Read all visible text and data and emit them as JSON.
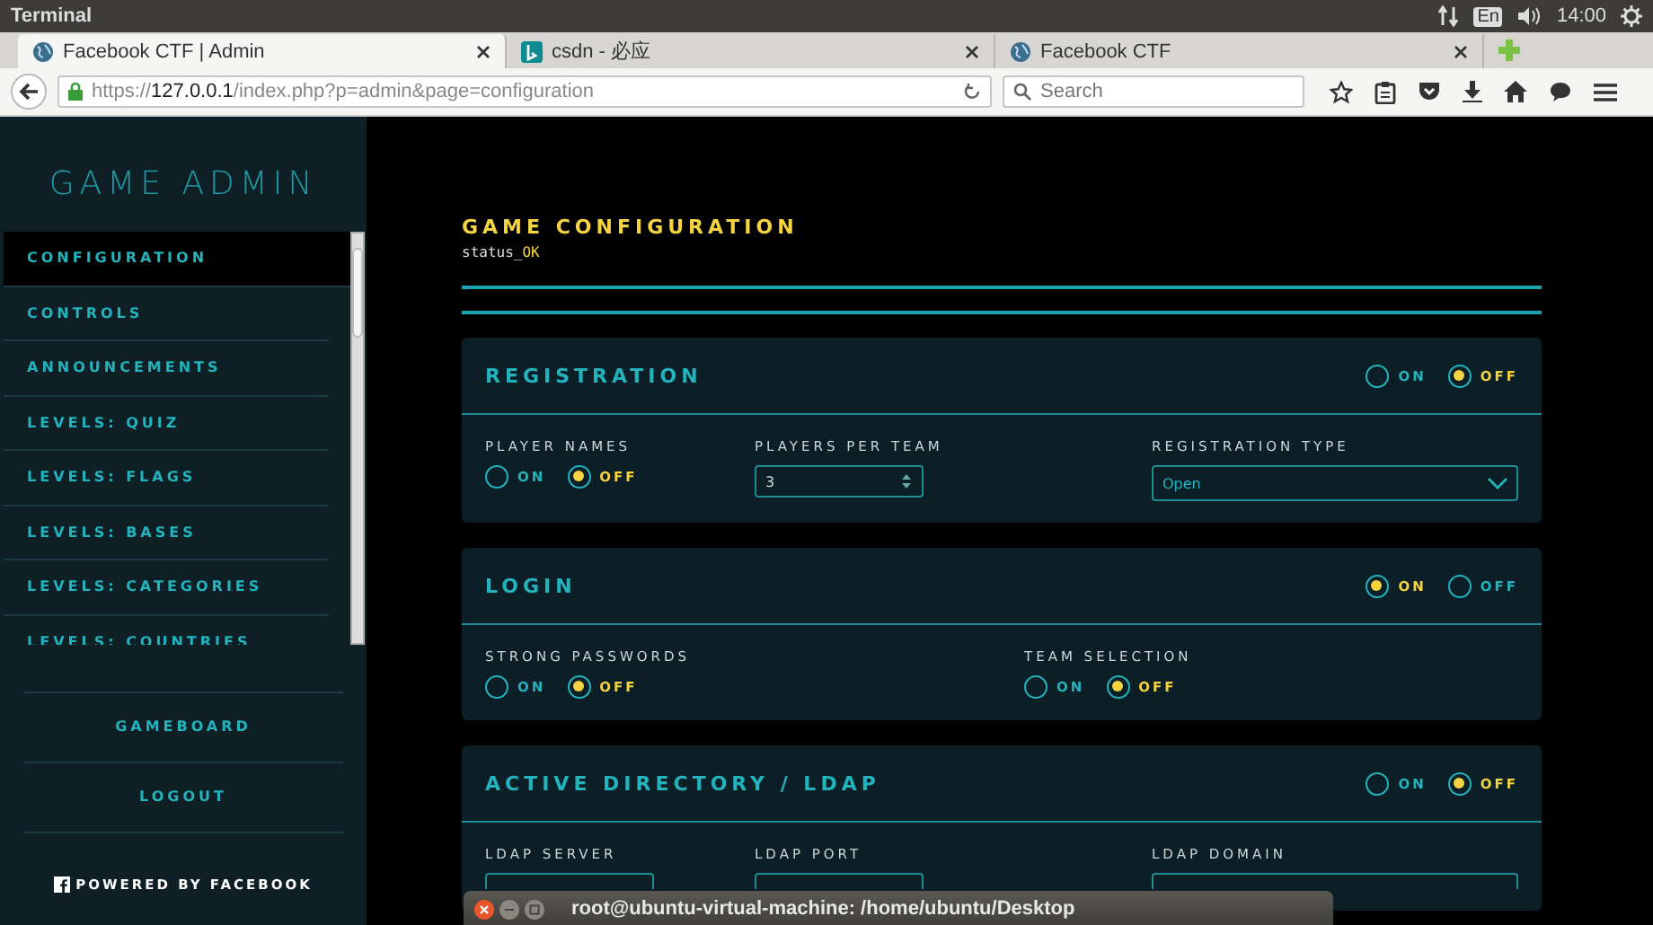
{
  "top_panel": {
    "app_title": "Terminal",
    "input_indicator": "En",
    "time": "14:00"
  },
  "browser": {
    "tabs": [
      {
        "title": "Facebook CTF | Admin",
        "selected": true
      },
      {
        "title": "csdn - 必应",
        "selected": false
      },
      {
        "title": "Facebook CTF",
        "selected": false
      }
    ],
    "url": {
      "scheme": "https://",
      "host": "127.0.0.1",
      "path": "/index.php?p=admin&page=configuration"
    },
    "search": {
      "placeholder": "Search"
    }
  },
  "sidebar": {
    "title": "GAME ADMIN",
    "items": [
      {
        "label": "CONFIGURATION",
        "selected": true
      },
      {
        "label": "CONTROLS",
        "selected": false
      },
      {
        "label": "ANNOUNCEMENTS",
        "selected": false
      },
      {
        "label": "LEVELS: QUIZ",
        "selected": false
      },
      {
        "label": "LEVELS: FLAGS",
        "selected": false
      },
      {
        "label": "LEVELS: BASES",
        "selected": false
      },
      {
        "label": "LEVELS: CATEGORIES",
        "selected": false
      },
      {
        "label": "LEVELS: COUNTRIES",
        "selected": false
      }
    ],
    "links": [
      "GAMEBOARD",
      "LOGOUT"
    ],
    "footer": "POWERED BY FACEBOOK"
  },
  "main": {
    "title": "GAME CONFIGURATION",
    "status": {
      "label": "status_",
      "value": "OK"
    },
    "sections": [
      {
        "title": "REGISTRATION",
        "toggle": [
          {
            "label": "ON",
            "selected": false
          },
          {
            "label": "OFF",
            "selected": true
          }
        ],
        "fields": [
          {
            "kind": "radio",
            "label": "PLAYER NAMES",
            "options": [
              {
                "label": "ON",
                "selected": false
              },
              {
                "label": "OFF",
                "selected": true
              }
            ]
          },
          {
            "kind": "number",
            "label": "PLAYERS PER TEAM",
            "value": "3"
          },
          {
            "kind": "select",
            "label": "REGISTRATION TYPE",
            "value": "Open"
          }
        ]
      },
      {
        "title": "LOGIN",
        "toggle": [
          {
            "label": "ON",
            "selected": true
          },
          {
            "label": "OFF",
            "selected": false
          }
        ],
        "fields": [
          {
            "kind": "radio",
            "label": "STRONG PASSWORDS",
            "options": [
              {
                "label": "ON",
                "selected": false
              },
              {
                "label": "OFF",
                "selected": true
              }
            ]
          },
          {
            "kind": "radio",
            "label": "TEAM SELECTION",
            "options": [
              {
                "label": "ON",
                "selected": false
              },
              {
                "label": "OFF",
                "selected": true
              }
            ]
          }
        ]
      },
      {
        "title": "ACTIVE DIRECTORY / LDAP",
        "toggle": [
          {
            "label": "ON",
            "selected": false
          },
          {
            "label": "OFF",
            "selected": true
          }
        ],
        "fields": [
          {
            "kind": "text",
            "label": "LDAP SERVER"
          },
          {
            "kind": "text",
            "label": "LDAP PORT"
          },
          {
            "kind": "text",
            "label": "LDAP DOMAIN"
          }
        ]
      }
    ]
  },
  "terminal_window": {
    "title": "root@ubuntu-virtual-machine: /home/ubuntu/Desktop"
  }
}
